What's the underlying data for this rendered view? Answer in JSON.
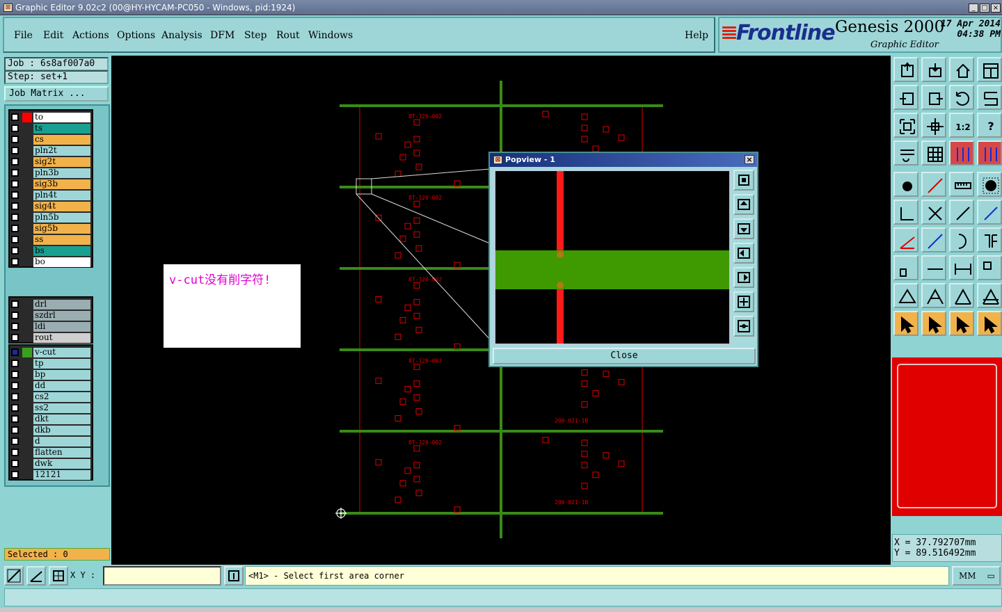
{
  "window": {
    "title": "Graphic Editor 9.02c2 (00@HY-HYCAM-PC050 - Windows, pid:1924)"
  },
  "menu": {
    "items": [
      "File",
      "Edit",
      "Actions",
      "Options",
      "Analysis",
      "DFM",
      "Step",
      "Rout",
      "Windows"
    ],
    "help": "Help"
  },
  "branding": {
    "logo": "Frontline",
    "product": "Genesis 2000",
    "subtitle": "Graphic Editor",
    "date": "17 Apr 2014",
    "time": "04:38 PM"
  },
  "job": {
    "job_line": "Job : 6s8af007a0",
    "step_line": "Step: set+1",
    "matrix_button": "Job Matrix ..."
  },
  "layers": {
    "group1": [
      {
        "name": "to",
        "swatch": "#ff0000",
        "bg": "#ffffff"
      },
      {
        "name": "ts",
        "swatch": "",
        "bg": "#1aa090"
      },
      {
        "name": "cs",
        "swatch": "",
        "bg": "#f2b24a"
      },
      {
        "name": "pln2t",
        "swatch": "",
        "bg": "#9ed6d8"
      },
      {
        "name": "sig2t",
        "swatch": "",
        "bg": "#f2b24a"
      },
      {
        "name": "pln3b",
        "swatch": "",
        "bg": "#9ed6d8"
      },
      {
        "name": "sig3b",
        "swatch": "",
        "bg": "#f2b24a"
      },
      {
        "name": "pln4t",
        "swatch": "",
        "bg": "#9ed6d8"
      },
      {
        "name": "sig4t",
        "swatch": "",
        "bg": "#f2b24a"
      },
      {
        "name": "pln5b",
        "swatch": "",
        "bg": "#9ed6d8"
      },
      {
        "name": "sig5b",
        "swatch": "",
        "bg": "#f2b24a"
      },
      {
        "name": "ss",
        "swatch": "",
        "bg": "#f2b24a"
      },
      {
        "name": "bs",
        "swatch": "",
        "bg": "#1aa090"
      },
      {
        "name": "bo",
        "swatch": "",
        "bg": "#ffffff"
      }
    ],
    "group2": [
      {
        "name": "drl",
        "swatch": "",
        "bg": "#9aaeb2"
      },
      {
        "name": "szdrl",
        "swatch": "",
        "bg": "#9aaeb2"
      },
      {
        "name": "ldi",
        "swatch": "",
        "bg": "#9aaeb2"
      },
      {
        "name": "rout",
        "swatch": "",
        "bg": "#cfcfcf"
      }
    ],
    "group3": [
      {
        "name": "v-cut",
        "swatch": "#3aa020",
        "bg": "#9ed6d8",
        "active": true
      },
      {
        "name": "tp",
        "swatch": "",
        "bg": "#9ed6d8"
      },
      {
        "name": "bp",
        "swatch": "",
        "bg": "#9ed6d8"
      },
      {
        "name": "dd",
        "swatch": "",
        "bg": "#9ed6d8"
      },
      {
        "name": "cs2",
        "swatch": "",
        "bg": "#9ed6d8"
      },
      {
        "name": "ss2",
        "swatch": "",
        "bg": "#9ed6d8"
      },
      {
        "name": "dkt",
        "swatch": "",
        "bg": "#9ed6d8"
      },
      {
        "name": "dkb",
        "swatch": "",
        "bg": "#9ed6d8"
      },
      {
        "name": "d",
        "swatch": "",
        "bg": "#9ed6d8"
      },
      {
        "name": "flatten",
        "swatch": "",
        "bg": "#9ed6d8"
      },
      {
        "name": "dwk",
        "swatch": "",
        "bg": "#9ed6d8"
      },
      {
        "name": "12121",
        "swatch": "",
        "bg": "#9ed6d8"
      }
    ]
  },
  "status": {
    "selected": "Selected : 0"
  },
  "canvas": {
    "note_text": "v-cut没有削字符!",
    "board_label_up": "200-021-1B",
    "board_label_down": "8T-120-002",
    "colors": {
      "vcut": "#3a8a18",
      "outline": "#e00000"
    }
  },
  "popview": {
    "title": "Popview - 1",
    "close_label": "Close"
  },
  "coords": {
    "x": "X = 37.792707mm",
    "y": "Y = 89.516492mm"
  },
  "bottom": {
    "xy_label": "X Y :",
    "xy_value": "",
    "prompt": "<M1> - Select first area corner",
    "units": "MM"
  }
}
